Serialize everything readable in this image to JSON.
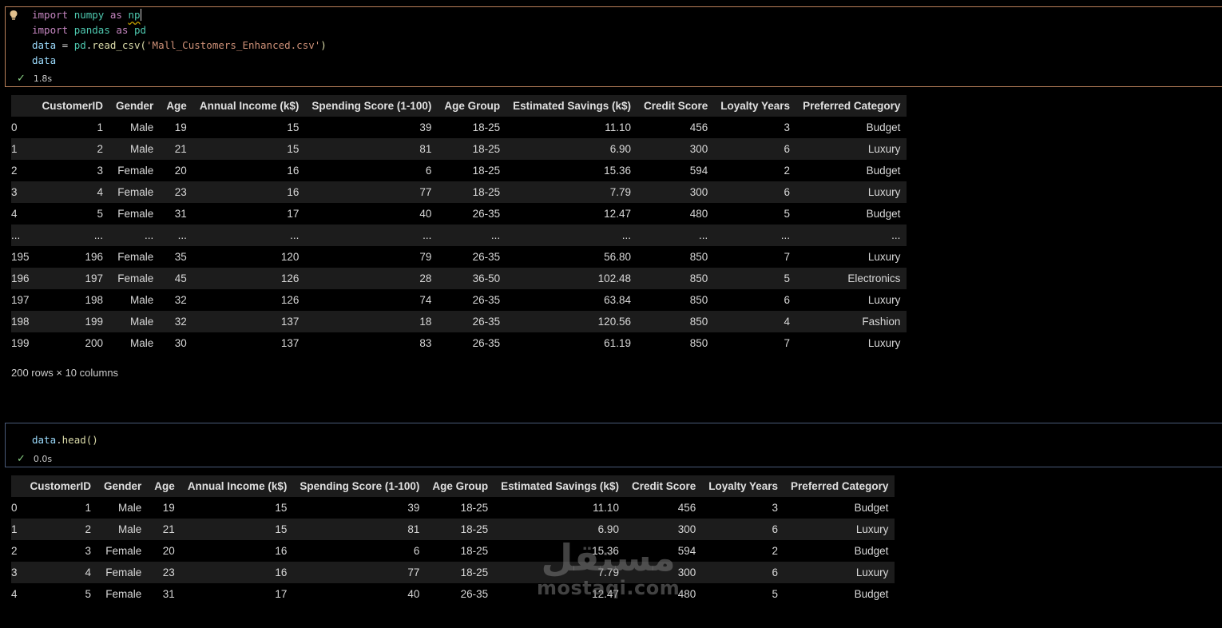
{
  "cell1": {
    "code_lines": [
      [
        "import",
        " numpy ",
        "as",
        " np"
      ],
      [
        "import",
        " pandas ",
        "as",
        " pd"
      ]
    ],
    "line1": {
      "kw1": "import",
      "mod": "numpy",
      "kw2": "as",
      "alias": "np"
    },
    "line2": {
      "kw1": "import",
      "mod": "pandas",
      "kw2": "as",
      "alias": "pd"
    },
    "line3": {
      "var": "data",
      "op": " = ",
      "obj": "pd",
      "dot": ".",
      "fn": "read_csv",
      "open": "(",
      "str": "'Mall_Customers_Enhanced.csv'",
      "close": ")"
    },
    "line4": {
      "var": "data"
    },
    "status_time": "1.8s"
  },
  "table1": {
    "columns": [
      "",
      "CustomerID",
      "Gender",
      "Age",
      "Annual Income (k$)",
      "Spending Score (1-100)",
      "Age Group",
      "Estimated Savings (k$)",
      "Credit Score",
      "Loyalty Years",
      "Preferred Category"
    ],
    "rows": [
      [
        "0",
        "1",
        "Male",
        "19",
        "15",
        "39",
        "18-25",
        "11.10",
        "456",
        "3",
        "Budget"
      ],
      [
        "1",
        "2",
        "Male",
        "21",
        "15",
        "81",
        "18-25",
        "6.90",
        "300",
        "6",
        "Luxury"
      ],
      [
        "2",
        "3",
        "Female",
        "20",
        "16",
        "6",
        "18-25",
        "15.36",
        "594",
        "2",
        "Budget"
      ],
      [
        "3",
        "4",
        "Female",
        "23",
        "16",
        "77",
        "18-25",
        "7.79",
        "300",
        "6",
        "Luxury"
      ],
      [
        "4",
        "5",
        "Female",
        "31",
        "17",
        "40",
        "26-35",
        "12.47",
        "480",
        "5",
        "Budget"
      ],
      [
        "...",
        "...",
        "...",
        "...",
        "...",
        "...",
        "...",
        "...",
        "...",
        "...",
        "..."
      ],
      [
        "195",
        "196",
        "Female",
        "35",
        "120",
        "79",
        "26-35",
        "56.80",
        "850",
        "7",
        "Luxury"
      ],
      [
        "196",
        "197",
        "Female",
        "45",
        "126",
        "28",
        "36-50",
        "102.48",
        "850",
        "5",
        "Electronics"
      ],
      [
        "197",
        "198",
        "Male",
        "32",
        "126",
        "74",
        "26-35",
        "63.84",
        "850",
        "6",
        "Luxury"
      ],
      [
        "198",
        "199",
        "Male",
        "32",
        "137",
        "18",
        "26-35",
        "120.56",
        "850",
        "4",
        "Fashion"
      ],
      [
        "199",
        "200",
        "Male",
        "30",
        "137",
        "83",
        "26-35",
        "61.19",
        "850",
        "7",
        "Luxury"
      ]
    ],
    "summary": "200 rows × 10 columns"
  },
  "cell2": {
    "line1": {
      "var": "data",
      "dot": ".",
      "fn": "head",
      "parens": "()"
    },
    "status_time": "0.0s"
  },
  "table2": {
    "columns": [
      "",
      "CustomerID",
      "Gender",
      "Age",
      "Annual Income (k$)",
      "Spending Score (1-100)",
      "Age Group",
      "Estimated Savings (k$)",
      "Credit Score",
      "Loyalty Years",
      "Preferred Category"
    ],
    "rows": [
      [
        "0",
        "1",
        "Male",
        "19",
        "15",
        "39",
        "18-25",
        "11.10",
        "456",
        "3",
        "Budget"
      ],
      [
        "1",
        "2",
        "Male",
        "21",
        "15",
        "81",
        "18-25",
        "6.90",
        "300",
        "6",
        "Luxury"
      ],
      [
        "2",
        "3",
        "Female",
        "20",
        "16",
        "6",
        "18-25",
        "15.36",
        "594",
        "2",
        "Budget"
      ],
      [
        "3",
        "4",
        "Female",
        "23",
        "16",
        "77",
        "18-25",
        "7.79",
        "300",
        "6",
        "Luxury"
      ],
      [
        "4",
        "5",
        "Female",
        "31",
        "17",
        "40",
        "26-35",
        "12.47",
        "480",
        "5",
        "Budget"
      ]
    ]
  },
  "watermark": {
    "arabic": "مستقل",
    "latin": "mostaqi.com"
  },
  "icons": {
    "bulb": "lightbulb-icon",
    "check": "check-icon"
  }
}
